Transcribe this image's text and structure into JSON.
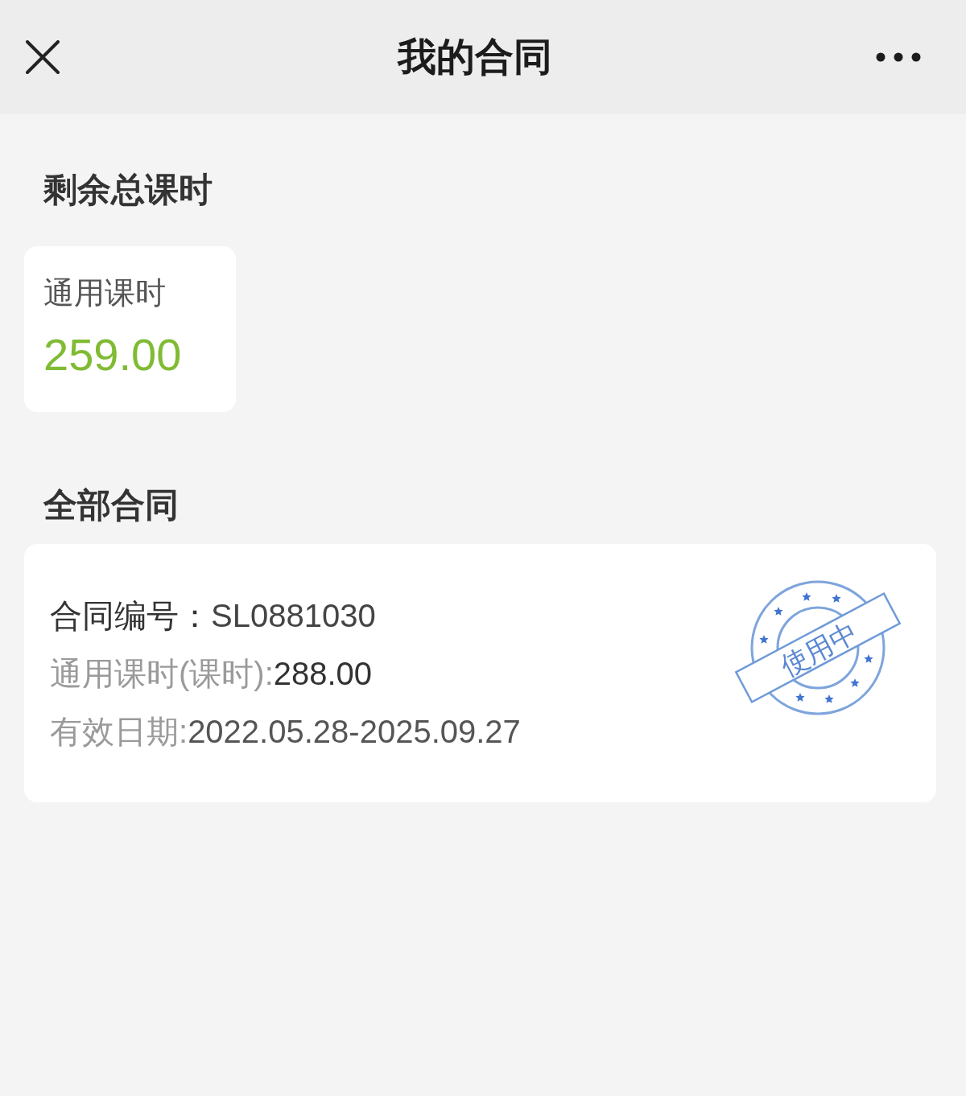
{
  "header": {
    "title": "我的合同"
  },
  "remaining": {
    "heading": "剩余总课时",
    "cards": [
      {
        "label": "通用课时",
        "value": "259.00"
      }
    ]
  },
  "contracts": {
    "heading": "全部合同",
    "items": [
      {
        "number_label": "合同编号：",
        "number": "SL0881030",
        "hours_label": "通用课时(课时):",
        "hours": "288.00",
        "validity_label": "有效日期:",
        "validity": "2022.05.28-2025.09.27",
        "status": "使用中"
      }
    ]
  }
}
